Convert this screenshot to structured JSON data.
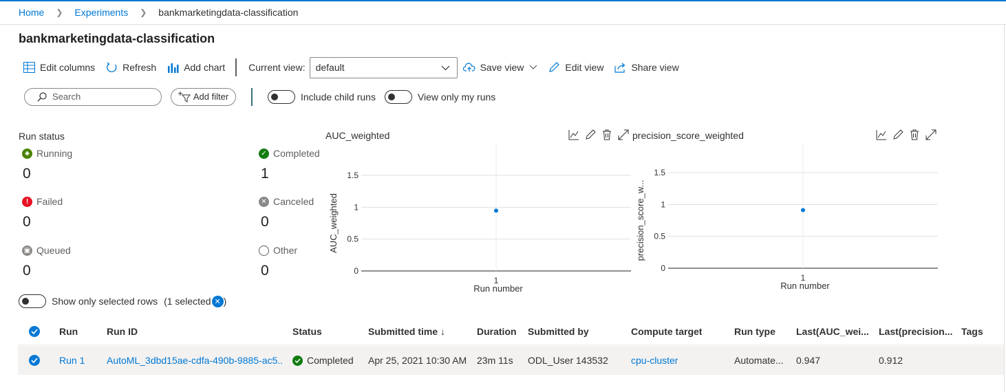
{
  "breadcrumb": {
    "home": "Home",
    "experiments": "Experiments",
    "current": "bankmarketingdata-classification"
  },
  "page_title": "bankmarketingdata-classification",
  "toolbar": {
    "edit_columns": "Edit columns",
    "refresh": "Refresh",
    "add_chart": "Add chart",
    "current_view_label": "Current view:",
    "current_view_value": "default",
    "save_view": "Save view",
    "edit_view": "Edit view",
    "share_view": "Share view"
  },
  "filters": {
    "search_placeholder": "Search",
    "add_filter": "Add filter",
    "include_child_runs": "Include child runs",
    "view_only_my_runs": "View only my runs"
  },
  "run_status": {
    "title": "Run status",
    "running": {
      "label": "Running",
      "count": "0"
    },
    "completed": {
      "label": "Completed",
      "count": "1"
    },
    "failed": {
      "label": "Failed",
      "count": "0"
    },
    "canceled": {
      "label": "Canceled",
      "count": "0"
    },
    "queued": {
      "label": "Queued",
      "count": "0"
    },
    "other": {
      "label": "Other",
      "count": "0"
    }
  },
  "chart_data": [
    {
      "type": "scatter",
      "title": "AUC_weighted",
      "xlabel": "Run number",
      "ylabel": "AUC_weighted",
      "x": [
        "1"
      ],
      "y": [
        0.947
      ],
      "yticks": [
        "0",
        "0.5",
        "1",
        "1.5"
      ],
      "ylim": [
        0,
        1.5
      ],
      "grid": true,
      "color": "#0078d4"
    },
    {
      "type": "scatter",
      "title": "precision_score_weighted",
      "xlabel": "Run number",
      "ylabel": "precision_score_w...",
      "x": [
        "1"
      ],
      "y": [
        0.912
      ],
      "yticks": [
        "0",
        "0.5",
        "1",
        "1.5"
      ],
      "ylim": [
        0,
        1.5
      ],
      "grid": true,
      "color": "#0078d4"
    }
  ],
  "selection": {
    "label": "Show only selected rows",
    "count_text": "(1 selected",
    "close_paren": ")"
  },
  "table": {
    "columns": [
      "Run",
      "Run ID",
      "Status",
      "Submitted time ↓",
      "Duration",
      "Submitted by",
      "Compute target",
      "Run type",
      "Last(AUC_wei...",
      "Last(precision...",
      "Tags"
    ],
    "rows": [
      {
        "run": "Run 1",
        "run_id": "AutoML_3dbd15ae-cdfa-490b-9885-ac5...",
        "status": "Completed",
        "submitted_time": "Apr 25, 2021 10:30 AM",
        "duration": "23m 11s",
        "submitted_by": "ODL_User 143532",
        "compute_target": "cpu-cluster",
        "run_type": "Automate...",
        "last_auc": "0.947",
        "last_precision": "0.912",
        "tags": ""
      }
    ]
  },
  "colors": {
    "accent": "#0078d4",
    "success": "#107c10",
    "failed": "#e81123",
    "neutral": "#8a8886"
  }
}
